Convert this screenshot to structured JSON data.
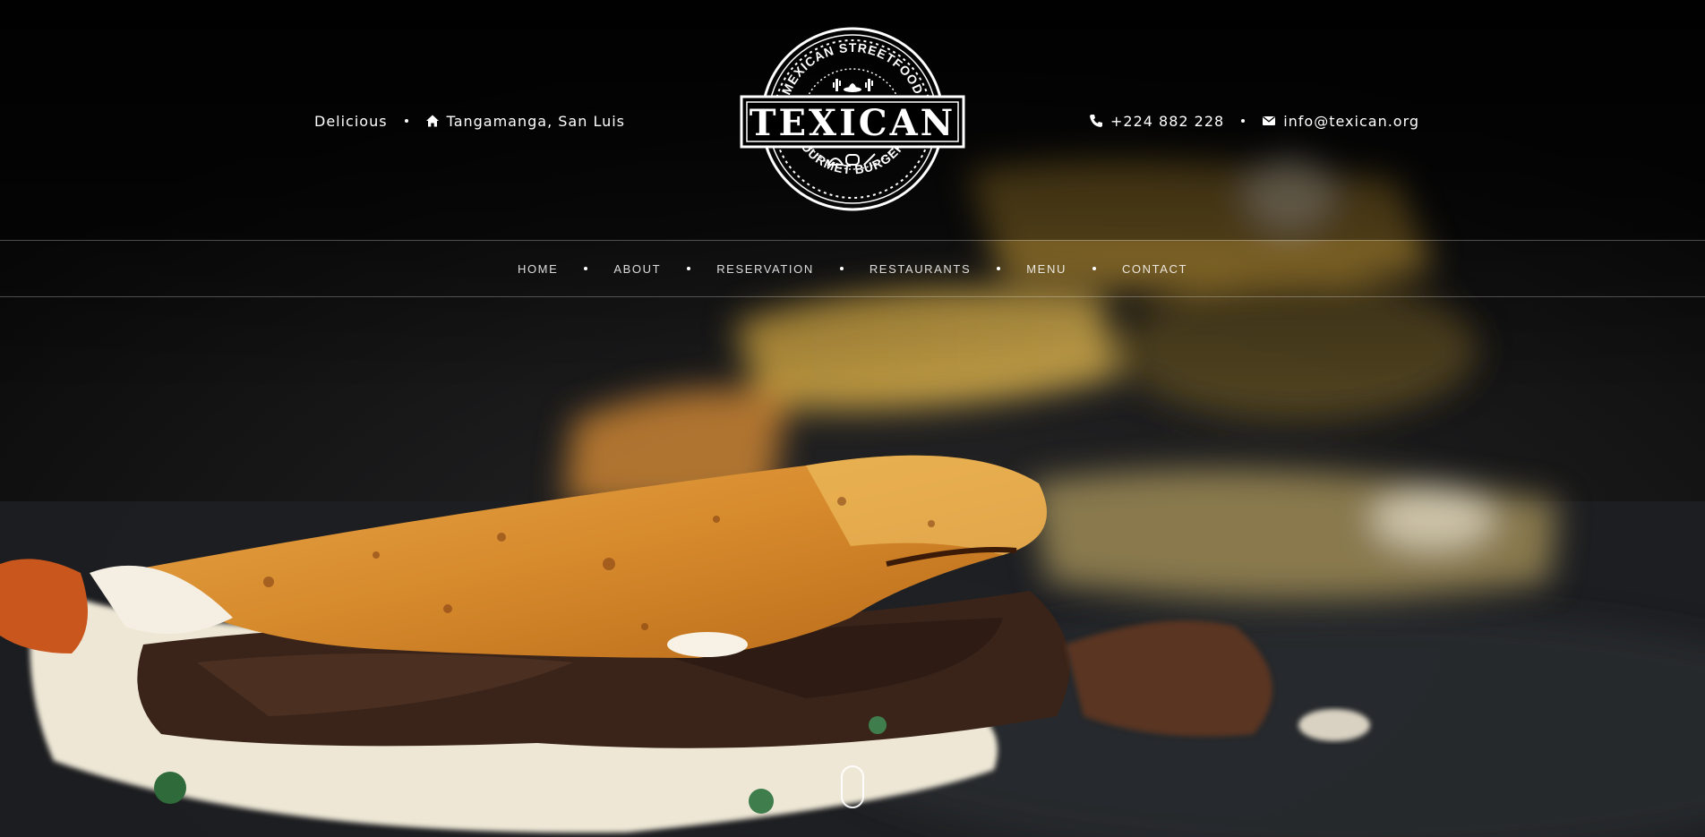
{
  "topbar": {
    "left": {
      "tagline": "Delicious",
      "location_icon": "home-icon",
      "location": "Tangamanga, San Luis"
    },
    "right": {
      "phone_icon": "phone-icon",
      "phone": "+224 882 228",
      "email_icon": "envelope-icon",
      "email": "info@texican.org"
    }
  },
  "logo": {
    "top_text": "MEXICAN STREETFOOD",
    "name": "TEXICAN",
    "bottom_text": "GOURMET BURGERS"
  },
  "nav": {
    "items": [
      {
        "label": "HOME"
      },
      {
        "label": "ABOUT"
      },
      {
        "label": "RESERVATION"
      },
      {
        "label": "RESTAURANTS"
      },
      {
        "label": "MENU"
      },
      {
        "label": "CONTACT"
      }
    ]
  },
  "scroll_indicator": {
    "icon": "mouse-scroll-icon"
  },
  "colors": {
    "background": "#0b0b0b",
    "text": "#ffffff",
    "divider": "rgba(255,255,255,0.28)"
  }
}
